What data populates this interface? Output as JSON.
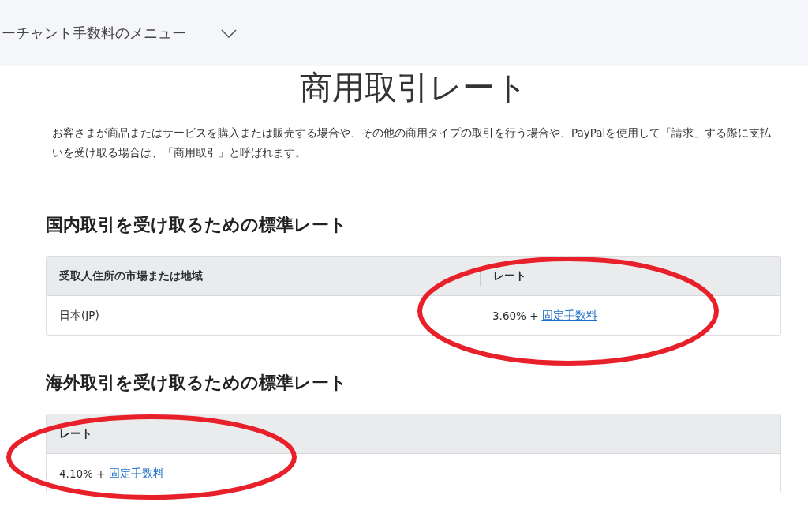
{
  "menu_bar": {
    "label": "ーチャント手数料のメニュー",
    "expanded": false
  },
  "title": "商用取引レート",
  "intro": "お客さまが商品またはサービスを購入または販売する場合や、その他の商用タイプの取引を行う場合や、PayPalを使用して「請求」する際に支払いを受け取る場合は、「商用取引」と呼ばれます。",
  "sections": [
    {
      "heading": "国内取引を受け取るための標準レート",
      "table": {
        "columns": [
          "受取人住所の市場または地域",
          "レート"
        ],
        "rows": [
          [
            {
              "text": "日本(JP)"
            },
            {
              "text": "3.60% +",
              "link": "固定手数料",
              "underlined": true
            }
          ]
        ]
      }
    },
    {
      "heading": "海外取引を受け取るための標準レート",
      "table": {
        "columns": [
          "レート"
        ],
        "rows": [
          [
            {
              "text": "4.10% +",
              "link": "固定手数料",
              "underlined": false
            }
          ]
        ]
      }
    }
  ]
}
